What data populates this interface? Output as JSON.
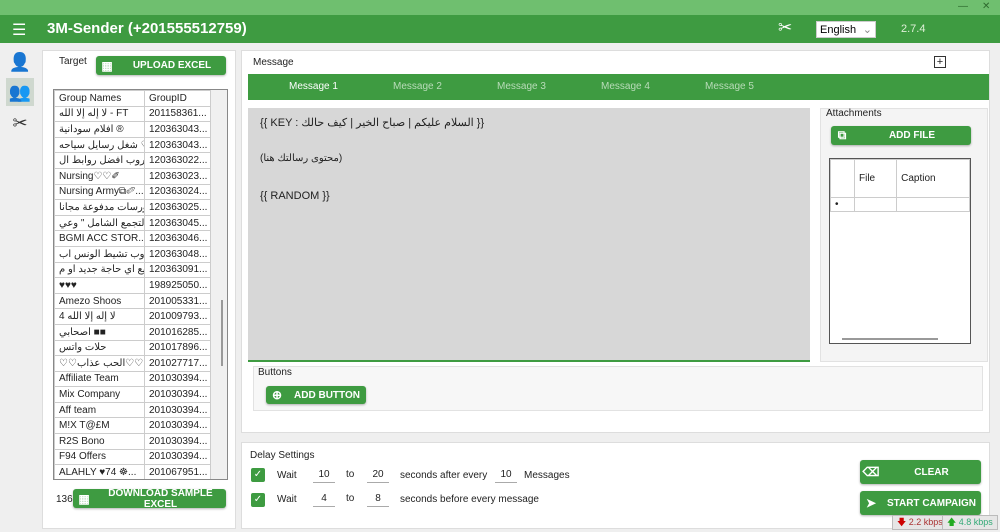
{
  "window": {
    "title": "3M-Sender (+201555512759)",
    "language": "English",
    "version": "2.7.4"
  },
  "target": {
    "label": "Target",
    "upload_label": "UPLOAD EXCEL",
    "download_label": "DOWNLOAD SAMPLE EXCEL",
    "count": "136",
    "columns": [
      "Group Names",
      "GroupID"
    ],
    "rows": [
      [
        "لا إله إلا الله - FT",
        "201158361..."
      ],
      [
        "افلام سودانية ®",
        "120363043..."
      ],
      [
        "شغل رسايل سياحه ♡",
        "120363043..."
      ],
      [
        "جروب افضل روابط ال...",
        "120363022..."
      ],
      [
        "Nursing♡♡✐",
        "120363023..."
      ],
      [
        "Nursing Army⧉✐...",
        "120363024..."
      ],
      [
        "كورسات مدفوعة مجانا",
        "120363025..."
      ],
      [
        "التجمع الشامل \" وعي ♀ \"",
        "120363045..."
      ],
      [
        "BGMI ACC STOR...",
        "120363046..."
      ],
      [
        "جروب تشيط الونس اب",
        "120363048..."
      ],
      [
        "بيع اي حاجة جديد او م...",
        "120363091..."
      ],
      [
        "♥♥♥",
        "198925050..."
      ],
      [
        "Amezo Shoos",
        "201005331..."
      ],
      [
        "لا إله إلا الله 4",
        "201009793..."
      ],
      [
        "اصحابي ■■",
        "201016285..."
      ],
      [
        "حلات واتس",
        "201017896..."
      ],
      [
        "♡♡الحب عذاب♡♡",
        "201027717..."
      ],
      [
        "Affiliate Team",
        "201030394..."
      ],
      [
        "Mix Company",
        "201030394..."
      ],
      [
        "Aff team",
        "201030394..."
      ],
      [
        "M!X T@£M",
        "201030394..."
      ],
      [
        "R2S Bono",
        "201030394..."
      ],
      [
        "F94 Offers",
        "201030394..."
      ],
      [
        "ALAHLY ♥74 ☸...",
        "201067951..."
      ]
    ]
  },
  "message": {
    "label": "Message",
    "tabs": [
      "Message 1",
      "Message 2",
      "Message 3",
      "Message 4",
      "Message 5"
    ],
    "lines": [
      "{{ KEY : السلام عليكم | صباح الخير | كيف حالك }}",
      "(محتوى رسالتك هنا)",
      "{{ RANDOM }}"
    ],
    "attachments_label": "Attachments",
    "add_file_label": "ADD FILE",
    "attach_columns": [
      "File",
      "Caption"
    ],
    "buttons_label": "Buttons",
    "add_button_label": "ADD BUTTON"
  },
  "delay": {
    "label": "Delay Settings",
    "row1": {
      "wait": "Wait",
      "from": "10",
      "to_label": "to",
      "to": "20",
      "after": "seconds after every",
      "count": "10",
      "messages": "Messages"
    },
    "row2": {
      "wait": "Wait",
      "from": "4",
      "to_label": "to",
      "to": "8",
      "after": "seconds before every message"
    },
    "clear_label": "CLEAR",
    "start_label": "START CAMPAIGN"
  },
  "network": {
    "down": "2.2 kbps",
    "up": "4.8 kbps"
  },
  "colors": {
    "primary": "#3e9b41",
    "strip": "#6fbf6f"
  }
}
